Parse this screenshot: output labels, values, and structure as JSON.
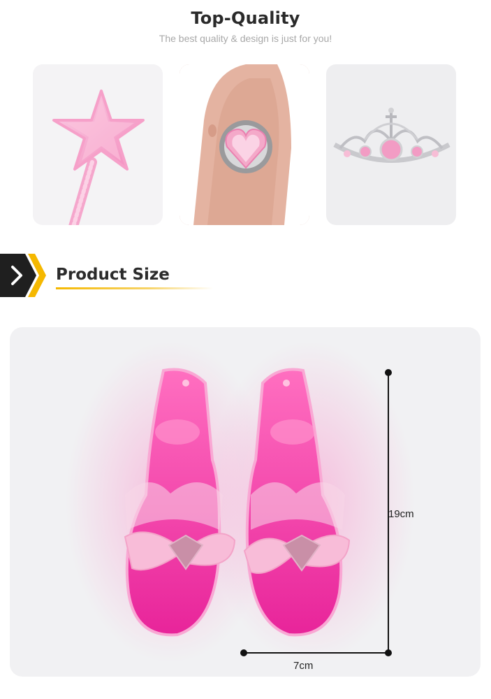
{
  "header": {
    "title": "Top-Quality",
    "subtitle": "The best quality & design is just for you!"
  },
  "gallery": [
    {
      "name": "star wand",
      "icon": "star-wand-image"
    },
    {
      "name": "heart ring",
      "icon": "heart-ring-image"
    },
    {
      "name": "tiara crown",
      "icon": "tiara-image"
    }
  ],
  "section": {
    "label": "Product Size",
    "icon": "chevron-right-icon",
    "accent": "#f5b800",
    "dark": "#1f1f1f"
  },
  "dimensions": {
    "height": "19cm",
    "width": "7cm"
  },
  "colors": {
    "pink": "#ff4fae",
    "light_pink": "#f7b7d7"
  }
}
